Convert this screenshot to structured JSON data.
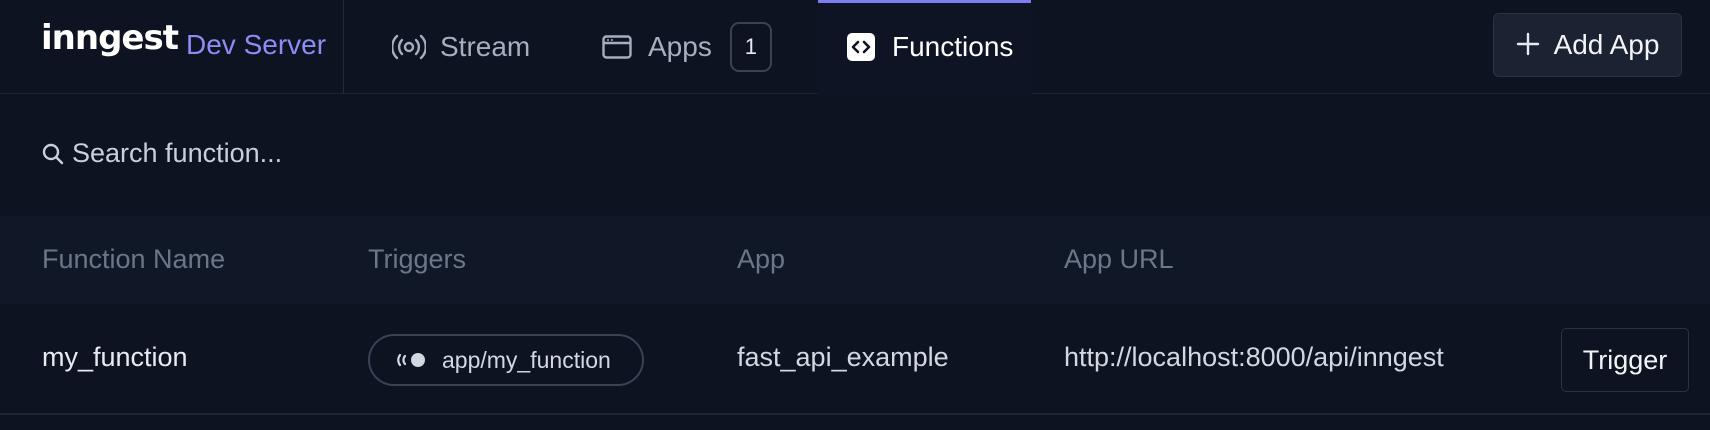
{
  "brand": {
    "logo": "inngest",
    "environment": "Dev Server"
  },
  "nav": {
    "tabs": [
      {
        "label": "Stream",
        "icon": "broadcast-icon",
        "active": false
      },
      {
        "label": "Apps",
        "icon": "window-icon",
        "count": "1",
        "active": false
      },
      {
        "label": "Functions",
        "icon": "code-icon",
        "active": true
      }
    ],
    "add_app_label": "Add App"
  },
  "search": {
    "placeholder": "Search function..."
  },
  "table": {
    "columns": [
      "Function Name",
      "Triggers",
      "App",
      "App URL"
    ],
    "rows": [
      {
        "function_name": "my_function",
        "trigger": "app/my_function",
        "app": "fast_api_example",
        "app_url": "http://localhost:8000/api/inngest",
        "action_label": "Trigger"
      }
    ]
  },
  "colors": {
    "accent": "#7d7ff0",
    "background": "#0e1322",
    "environment": "#8b8cf5"
  }
}
